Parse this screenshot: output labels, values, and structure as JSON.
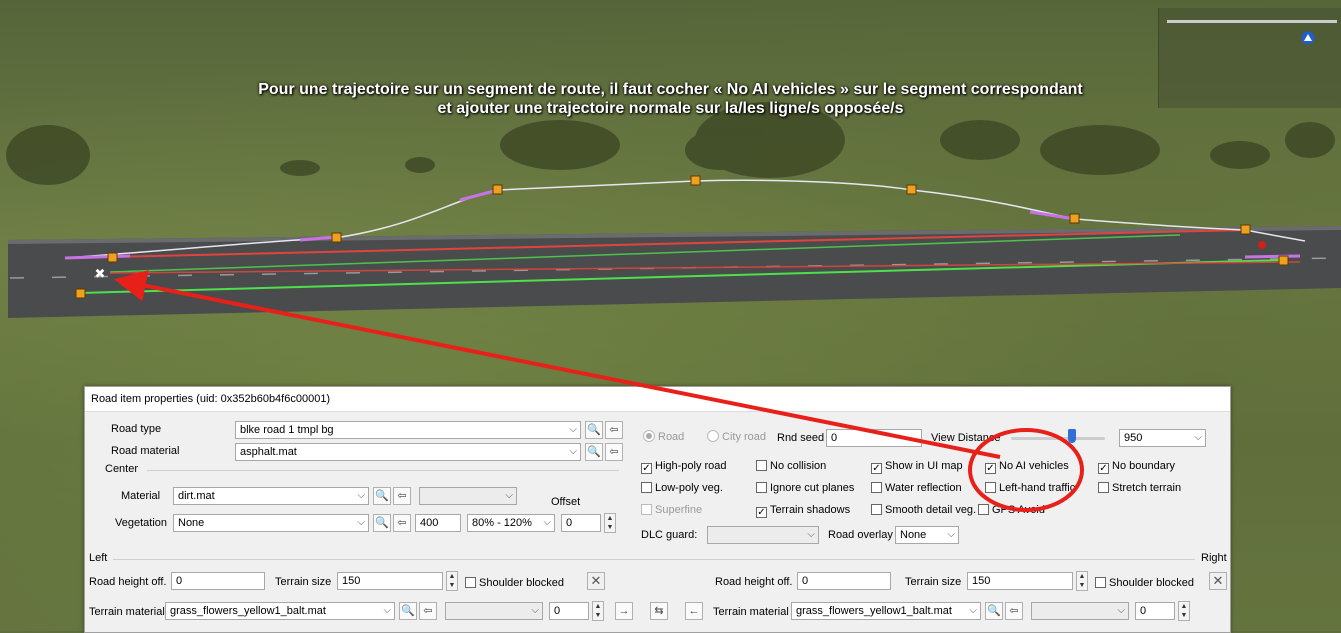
{
  "annotation": {
    "line1": "Pour une trajectoire sur un segment de route, il faut cocher « No AI vehicles » sur le segment correspondant",
    "line2": "et ajouter une trajectoire normale sur la/les ligne/s opposée/s"
  },
  "dialog": {
    "title": "Road item properties (uid: 0x352b60b4f6c00001)",
    "road_type_label": "Road type",
    "road_type_value": "blke road 1 tmpl bg",
    "road_material_label": "Road material",
    "road_material_value": "asphalt.mat",
    "center_label": "Center",
    "material_label": "Material",
    "material_value": "dirt.mat",
    "offset_label": "Offset",
    "vegetation_label": "Vegetation",
    "vegetation_value": "None",
    "vegetation_distance": "400",
    "vegetation_scale": "80% - 120%",
    "offset_value": "0",
    "radio_road": "Road",
    "radio_city_road": "City road",
    "rnd_seed_label": "Rnd seed",
    "rnd_seed_value": "0",
    "view_distance_label": "View Distance",
    "view_distance_value": "950",
    "checks": {
      "high_poly_road": "High-poly road",
      "no_collision": "No collision",
      "show_in_ui_map": "Show in UI map",
      "no_ai_vehicles": "No AI vehicles",
      "no_boundary": "No boundary",
      "low_poly_veg": "Low-poly veg.",
      "ignore_cut_planes": "Ignore cut planes",
      "water_reflection": "Water reflection",
      "left_hand_traffic": "Left-hand traffic",
      "stretch_terrain": "Stretch terrain",
      "superfine": "Superfine",
      "terrain_shadows": "Terrain shadows",
      "smooth_detail_veg": "Smooth detail veg.",
      "gps_avoid": "GPS Avoid"
    },
    "dlc_guard_label": "DLC guard:",
    "road_overlay_label": "Road overlay",
    "road_overlay_value": "None",
    "left_label": "Left",
    "right_label": "Right",
    "road_height_label": "Road height off.",
    "road_height_left": "0",
    "road_height_right": "0",
    "terrain_size_label": "Terrain size",
    "terrain_size_left": "150",
    "terrain_size_right": "150",
    "shoulder_blocked_label": "Shoulder blocked",
    "terrain_material_label": "Terrain material",
    "terrain_material_left": "grass_flowers_yellow1_balt.mat",
    "terrain_material_right": "grass_flowers_yellow1_balt.mat",
    "terrain_offset_left": "0",
    "terrain_offset_right": "0"
  },
  "icons": {
    "search": "🔍",
    "pick": "⇦",
    "swap": "⇆",
    "arrow_right": "→",
    "arrow_left": "←",
    "close": "✕",
    "dropdown": "⌵"
  },
  "colors": {
    "highlight_circle": "#e8201a",
    "pointer_arrow": "#e8201a",
    "lane_green": "#4ee04a",
    "lane_red": "#e0443c",
    "trajectory_purple": "#c773e6",
    "trajectory_white": "#e6e6f0",
    "node_orange": "#f0a020"
  }
}
